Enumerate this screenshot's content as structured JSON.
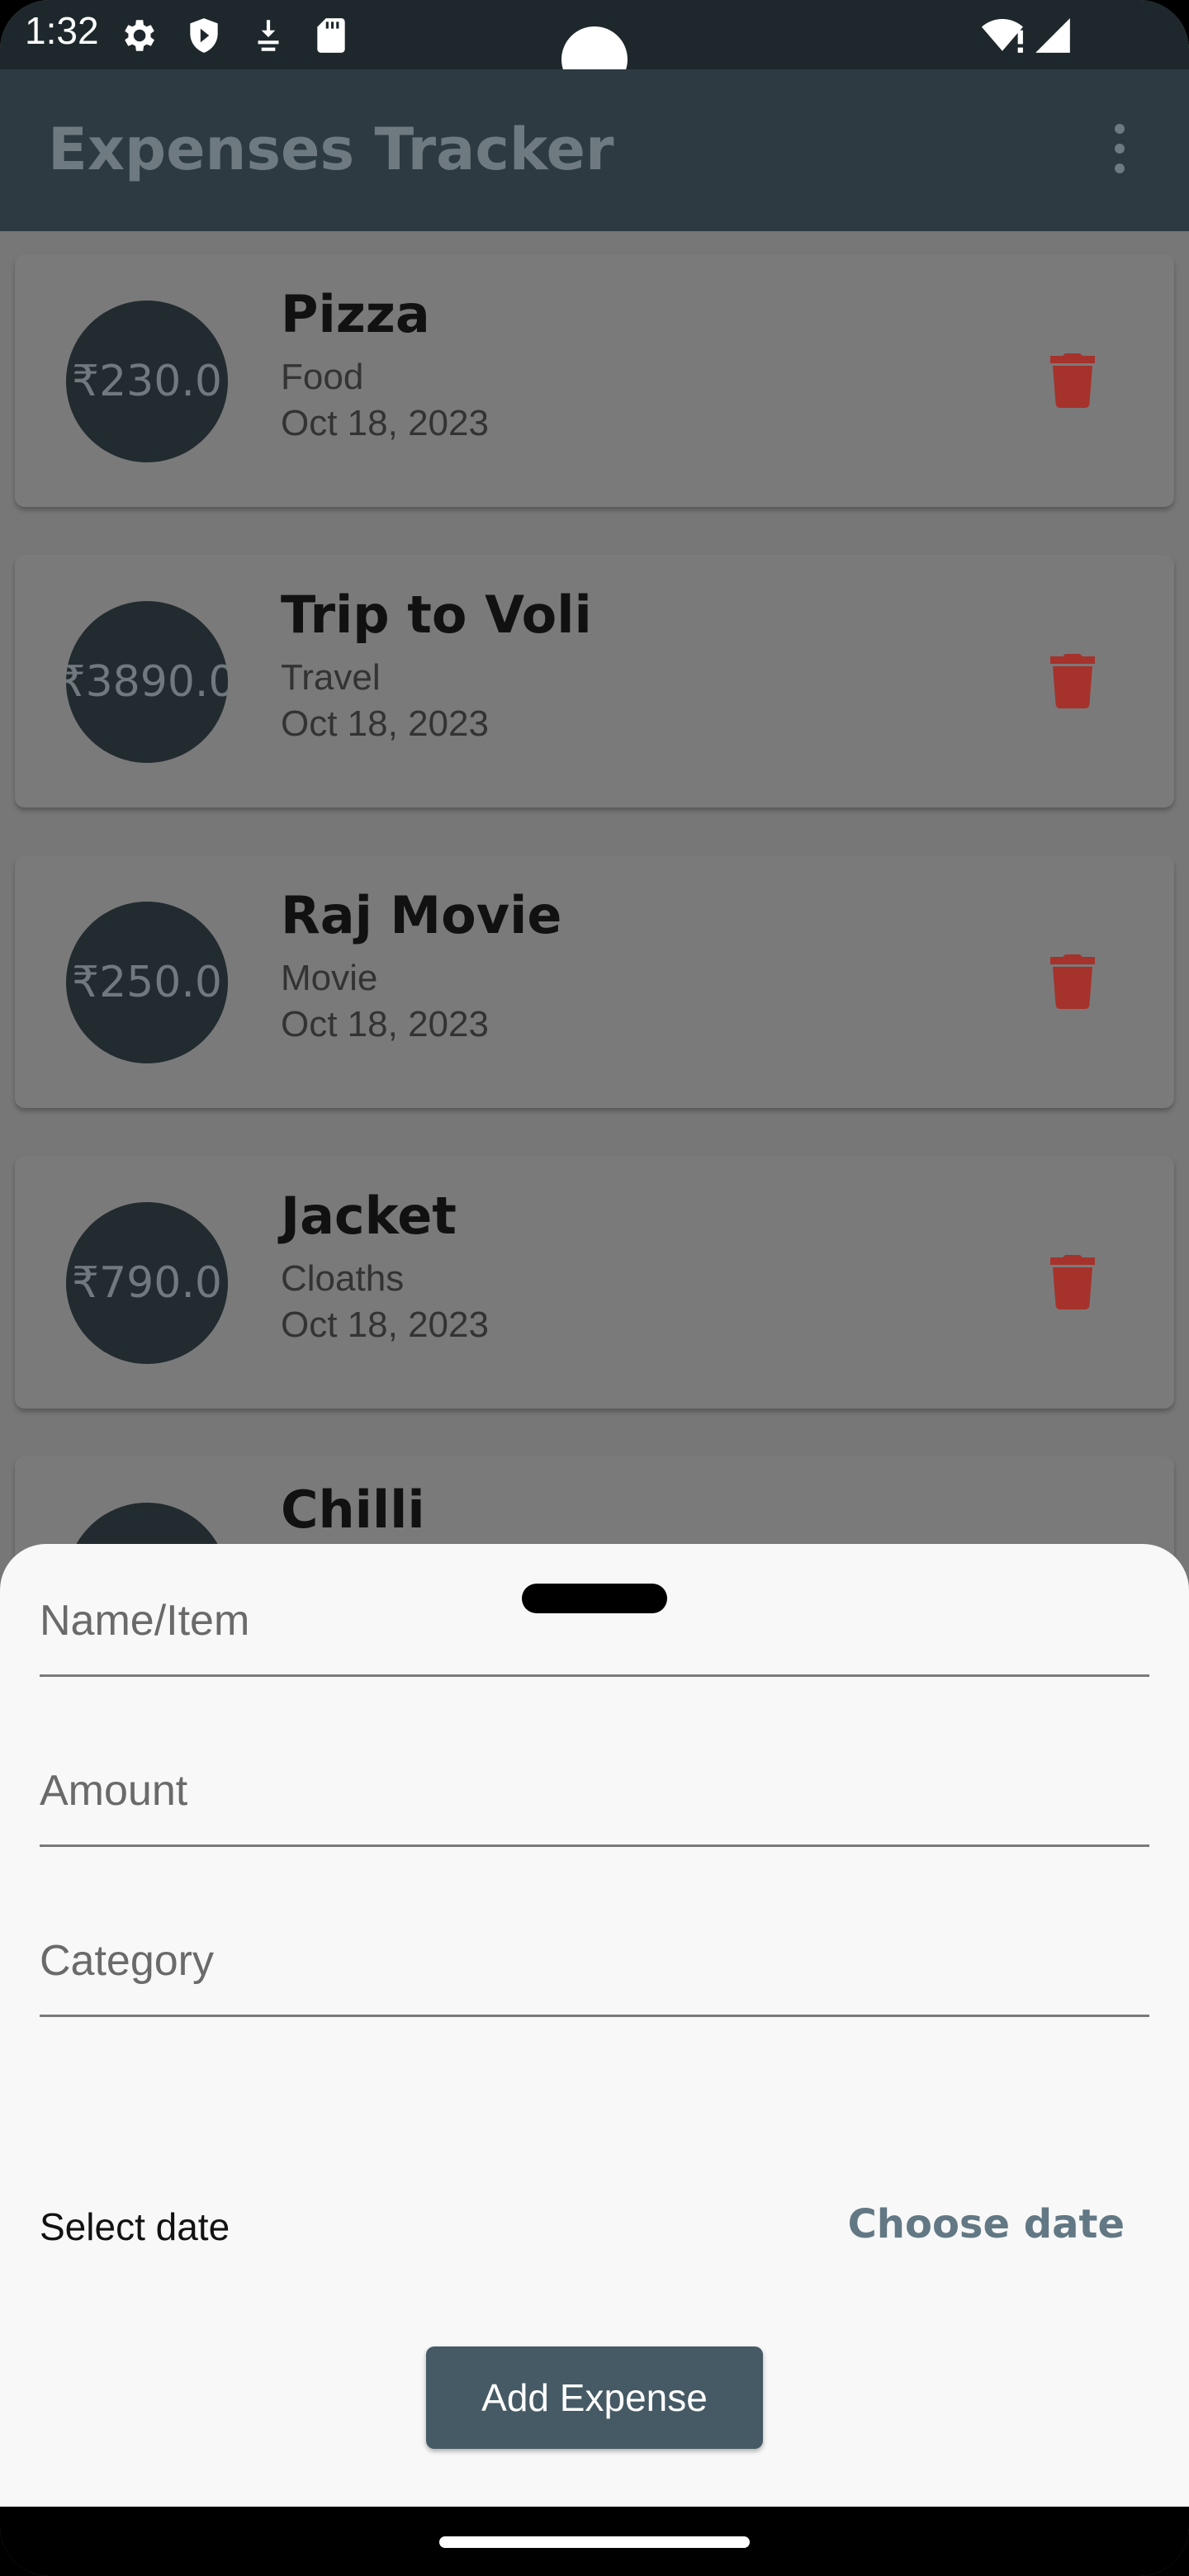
{
  "status_bar": {
    "time": "1:32",
    "icons": [
      "gear-icon",
      "shield-icon",
      "download-icon",
      "sd-card-icon",
      "wifi-alert-icon",
      "signal-icon"
    ]
  },
  "app_bar": {
    "title": "Expenses Tracker",
    "menu_icon": "more-vert-icon"
  },
  "expenses": [
    {
      "amount": "₹230.0",
      "title": "Pizza",
      "category": "Food",
      "date": "Oct 18, 2023"
    },
    {
      "amount": "₹3890.0",
      "title": "Trip to Voli",
      "category": "Travel",
      "date": "Oct 18, 2023"
    },
    {
      "amount": "₹250.0",
      "title": "Raj Movie",
      "category": "Movie",
      "date": "Oct 18, 2023"
    },
    {
      "amount": "₹790.0",
      "title": "Jacket",
      "category": "Cloaths",
      "date": "Oct 18, 2023"
    },
    {
      "amount": "",
      "title": "Chilli",
      "category": "",
      "date": ""
    }
  ],
  "form": {
    "name_placeholder": "Name/Item",
    "amount_placeholder": "Amount",
    "category_placeholder": "Category",
    "select_date_label": "Select date",
    "choose_date_label": "Choose date",
    "submit_label": "Add Expense"
  },
  "colors": {
    "app_bar": "#2d3a41",
    "accent": "#455a64",
    "delete": "#b3261e"
  }
}
